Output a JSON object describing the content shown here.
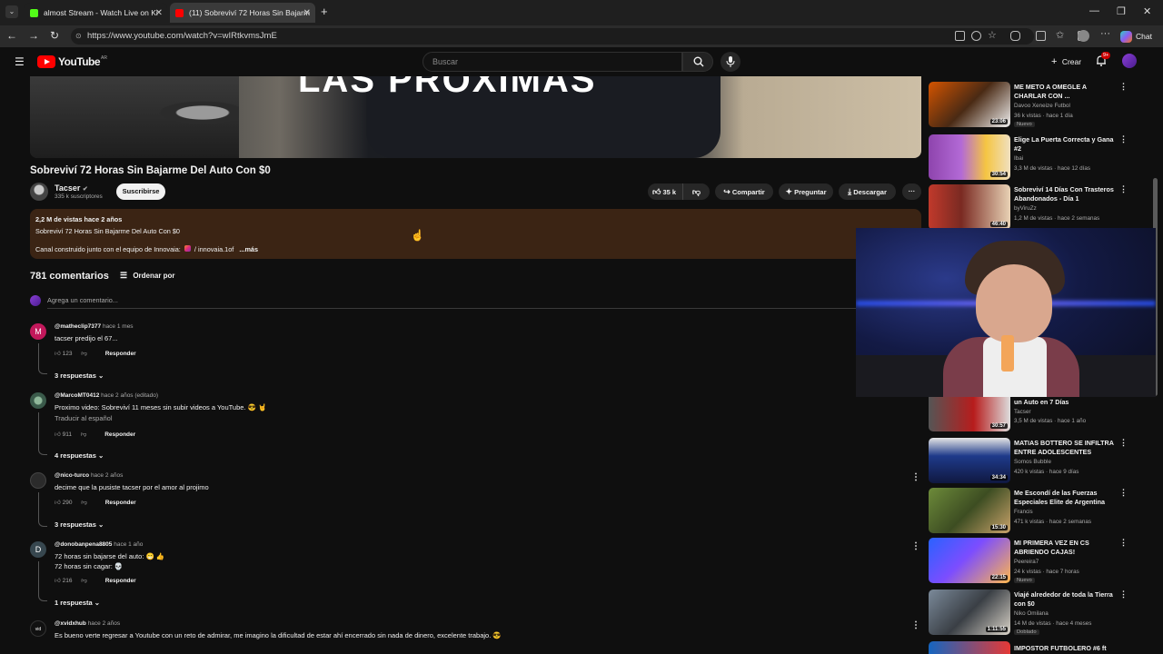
{
  "browser": {
    "tabs": [
      {
        "label": "almost Stream - Watch Live on Ki",
        "active": false
      },
      {
        "label": "(11) Sobreviví 72 Horas Sin Bajarm",
        "active": true
      }
    ],
    "url": "https://www.youtube.com/watch?v=wIRtkvmsJmE",
    "chat_label": "Chat"
  },
  "header": {
    "logo_text": "YouTube",
    "logo_region": "AR",
    "search_placeholder": "Buscar",
    "create_label": "Crear",
    "notifications_badge": "9+"
  },
  "video": {
    "overlay_text": "LAS PRÓXIMAS",
    "title": "Sobreviví 72 Horas Sin Bajarme Del Auto Con $0",
    "channel": "Tacser",
    "subscribers": "335 k suscriptores",
    "subscribe_label": "Suscribirse",
    "likes": "35 k",
    "share_label": "Compartir",
    "ask_label": "Preguntar",
    "download_label": "Descargar"
  },
  "description": {
    "stats": "2,2 M de vistas  hace 2 años",
    "line1": "Sobreviví 72 Horas Sin Bajarme Del Auto Con $0",
    "line2_prefix": "Canal construido junto con el equipo de Innovaia:",
    "line2_link": "/ innovaia.1of",
    "more": "...más"
  },
  "comments_section": {
    "count": "781 comentarios",
    "sort_label": "Ordenar por",
    "add_placeholder": "Agrega un comentario...",
    "reply_label": "Responder",
    "comments": [
      {
        "avatar_letter": "M",
        "author": "@matheclip7377",
        "time": "hace 1 mes",
        "text": "tacser predijo el 67...",
        "translate": "",
        "likes": "123",
        "replies": "3 respuestas",
        "avatar_color": "#c2185b"
      },
      {
        "avatar_letter": "",
        "author": "@MarcoMT0412",
        "time": "hace 2 años (editado)",
        "text": "Proximo video: Sobreviví 11 meses sin subir videos a YouTube. 😎 🤘",
        "translate": "Traducir al español",
        "likes": "911",
        "replies": "4 respuestas",
        "avatar_color": "#3a5a4a"
      },
      {
        "avatar_letter": "",
        "author": "@nico-turco",
        "time": "hace 2 años",
        "text": "decime que la pusiste tacser por el amor al projimo",
        "translate": "",
        "likes": "290",
        "replies": "3 respuestas",
        "avatar_color": "#2b2b2b"
      },
      {
        "avatar_letter": "D",
        "author": "@donobanpena8805",
        "time": "hace 1 año",
        "text": "72 horas sin bajarse del auto: 😁 👍",
        "text2": "72 horas sin cagar: 💀",
        "translate": "",
        "likes": "216",
        "replies": "1 respuesta",
        "avatar_color": "#37474f"
      },
      {
        "avatar_letter": "",
        "author": "@xvidxhub",
        "time": "hace 2 años",
        "text": "Es bueno verte regresar a Youtube con un reto de admirar, me imagino la dificultad de estar ahí encerrado sin nada de dinero, excelente trabajo. 😎",
        "translate": "",
        "likes": "",
        "replies": "",
        "avatar_color": "#222"
      }
    ]
  },
  "sidebar": {
    "recommendations": [
      {
        "title": "ME METO A OMEGLE A CHARLAR CON ...",
        "channel": "Davoo Xeneize Futbol",
        "stats": "36 k vistas · hace 1 día",
        "badge": "Nuevo",
        "duration": "23:06",
        "thumb": [
          "#d35400",
          "#f0f0f0"
        ]
      },
      {
        "title": "Elige La Puerta Correcta y Gana #2",
        "channel": "Ibai",
        "stats": "3,3 M de vistas · hace 12 días",
        "badge": "",
        "duration": "30:54",
        "thumb": [
          "#8e44ad",
          "#f5c542"
        ]
      },
      {
        "title": "Sobreviví 14 Días Con Trasteros Abandonados - Día 1",
        "channel": "byViruZz",
        "stats": "1,2 M de vistas · hace 2 semanas",
        "badge": "",
        "duration": "46:40",
        "thumb": [
          "#c0392b",
          "#e8d2b5"
        ]
      },
      {
        "title": "un Auto en 7 Días",
        "channel": "Tacser",
        "stats": "3,5 M de vistas · hace 1 año",
        "badge": "",
        "duration": "30:57",
        "thumb": [
          "#b71c1c",
          "#dddddd"
        ]
      },
      {
        "title": "MATIAS BOTTERO SE INFILTRA ENTRE ADOLESCENTES",
        "channel": "Somos Bubble",
        "stats": "420 k vistas · hace 9 días",
        "badge": "",
        "duration": "34:34",
        "thumb": [
          "#1e3a8a",
          "#e6e6e6"
        ]
      },
      {
        "title": "Me Escondí de las Fuerzas Especiales Elite de Argentina",
        "channel": "Francis",
        "stats": "471 k vistas · hace 2 semanas",
        "badge": "",
        "duration": "15:30",
        "thumb": [
          "#6d8b3a",
          "#c9a36b"
        ]
      },
      {
        "title": "MI PRIMERA VEZ EN CS ABRIENDO CAJAS!",
        "channel": "Peereira7",
        "stats": "24 k vistas · hace 7 horas",
        "badge": "Nuevo",
        "duration": "22:15",
        "thumb": [
          "#2962ff",
          "#ffb74d"
        ]
      },
      {
        "title": "Viajé alrededor de toda la Tierra con $0",
        "channel": "Niko Omilana",
        "stats": "14 M de vistas · hace 4 meses",
        "badge": "Doblado",
        "duration": "1:11:55",
        "thumb": [
          "#7b8a9a",
          "#d9d3c8"
        ]
      },
      {
        "title": "IMPOSTOR FUTBOLERO #6 ft",
        "channel": "",
        "stats": "",
        "badge": "",
        "duration": "",
        "thumb": [
          "#1565c0",
          "#e53935"
        ]
      }
    ]
  }
}
